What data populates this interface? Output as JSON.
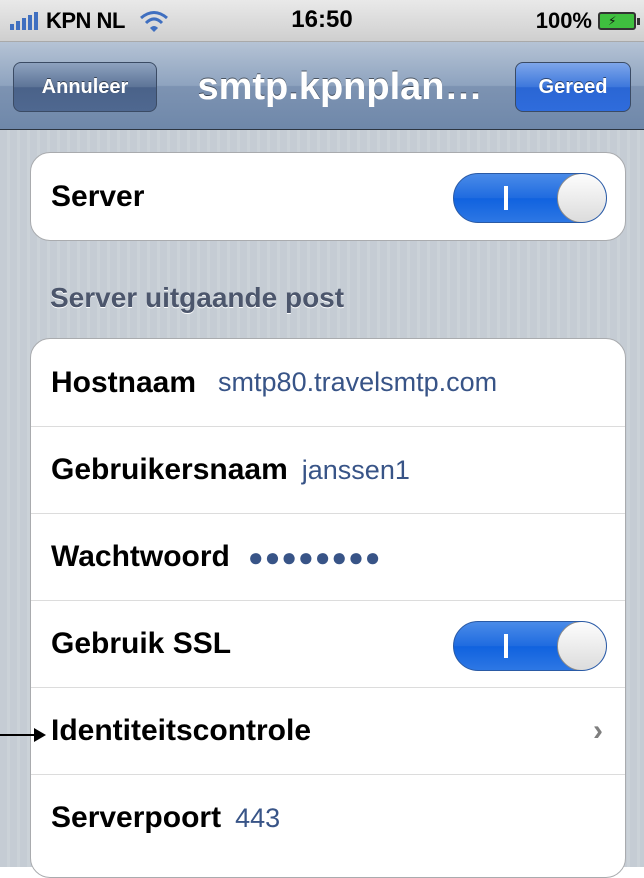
{
  "status_bar": {
    "carrier": "KPN NL",
    "time": "16:50",
    "battery": "100%",
    "icons": [
      "signal-icon",
      "wifi-icon",
      "battery-icon"
    ]
  },
  "nav": {
    "cancel_label": "Annuleer",
    "title": "smtp.kpnplan…",
    "done_label": "Gereed"
  },
  "server_group": {
    "label": "Server",
    "toggle_on": true,
    "toggle_mark": "I"
  },
  "section_header": "Server uitgaande post",
  "fields": {
    "hostname_label": "Hostnaam",
    "hostname_value": "smtp80.travelsmtp.com",
    "username_label": "Gebruikersnaam",
    "username_value": "janssen1",
    "password_label": "Wachtwoord",
    "password_value": "●●●●●●●●",
    "ssl_label": "Gebruik SSL",
    "ssl_on": true,
    "auth_label": "Identiteitscontrole",
    "port_label": "Serverpoort",
    "port_value": "443"
  },
  "colors": {
    "accent": "#2f6cdc",
    "value_text": "#385487",
    "background": "#c5ccd4"
  }
}
